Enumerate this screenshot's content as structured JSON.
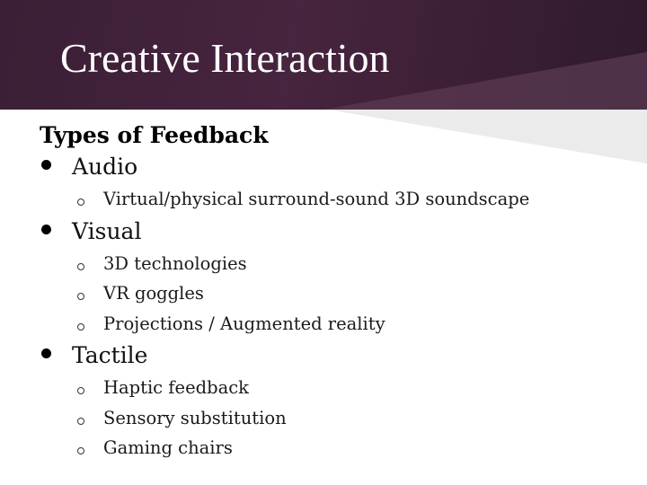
{
  "slide": {
    "title": "Creative Interaction",
    "heading": "Types of Feedback",
    "colors": {
      "header_dark": "#3a1f35",
      "header_light": "#5a3550",
      "body_wedge": "#ebebeb",
      "title_text": "#ffffff"
    },
    "bullets": [
      {
        "label": "Audio",
        "sub": [
          "Virtual/physical surround-sound 3D soundscape"
        ]
      },
      {
        "label": "Visual",
        "sub": [
          "3D technologies",
          "VR goggles",
          "Projections / Augmented reality"
        ]
      },
      {
        "label": "Tactile",
        "sub": [
          "Haptic feedback",
          "Sensory substitution",
          "Gaming chairs"
        ]
      }
    ]
  }
}
